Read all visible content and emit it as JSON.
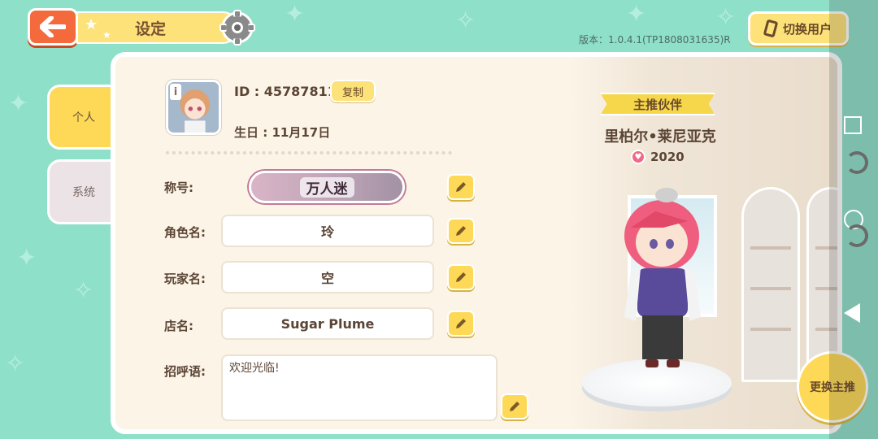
{
  "header": {
    "title": "设定",
    "version_text": "版本：1.0.4.1(TP1808031635)R",
    "switch_user_label": "切换用户"
  },
  "tabs": [
    {
      "label": "个人",
      "active": true
    },
    {
      "label": "系统",
      "active": false
    }
  ],
  "profile": {
    "id_text": "ID : 45787811",
    "copy_label": "复制",
    "birthday_text": "生日 : 11月17日",
    "title_label": "称号:",
    "title_badge": "万人迷",
    "role_name_label": "角色名:",
    "role_name_value": "玲",
    "player_name_label": "玩家名:",
    "player_name_value": "空",
    "shop_name_label": "店名:",
    "shop_name_value": "Sugar Plume",
    "greeting_label": "招呼语:",
    "greeting_value": "欢迎光临!"
  },
  "partner": {
    "ribbon": "主推伙伴",
    "name": "里柏尔•莱尼亚克",
    "affection": "2020",
    "swap_label": "更换主推"
  },
  "colors": {
    "background": "#8fe0c9",
    "accent_yellow": "#fdd957",
    "back_button": "#f46a3d",
    "panel": "#fbf4e7"
  }
}
